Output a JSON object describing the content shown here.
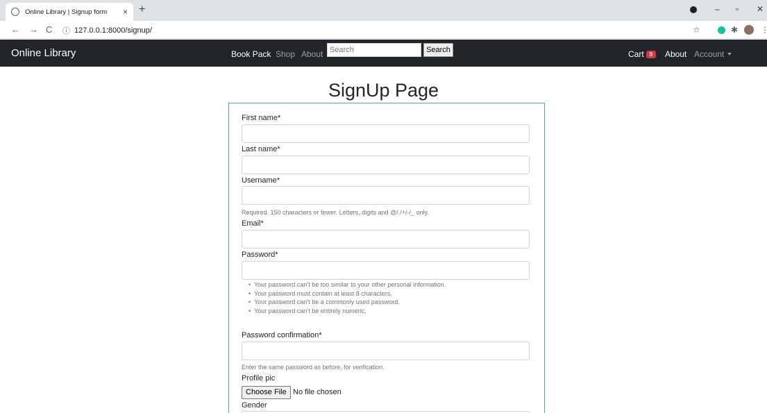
{
  "browser": {
    "tab_title": "Online Library | Signup form",
    "tab_close": "×",
    "new_tab": "+",
    "url": "127.0.0.1:8000/signup/",
    "nav": {
      "back": "←",
      "forward": "→",
      "reload": "C",
      "info": "ⓘ"
    },
    "window": {
      "minimize": "–",
      "maximize": "▫",
      "close": "✕"
    },
    "extensions": {
      "star": "☆",
      "puzzle": "✱",
      "menu": "⋮"
    }
  },
  "navbar": {
    "brand": "Online Library",
    "links": [
      "Book Pack",
      "Shop",
      "About"
    ],
    "search_placeholder": "Search",
    "search_button": "Search",
    "cart_label": "Cart",
    "cart_count": "0",
    "about_right": "About",
    "account": "Account"
  },
  "page": {
    "title": "SignUp Page"
  },
  "form": {
    "first_name_label": "First name*",
    "last_name_label": "Last name*",
    "username_label": "Username*",
    "username_help": "Required. 150 characters or fewer. Letters, digits and @/./+/-/_ only.",
    "email_label": "Email*",
    "password_label": "Password*",
    "password_rules": [
      "Your password can’t be too similar to your other personal information.",
      "Your password must contain at least 8 characters.",
      "Your password can’t be a commonly used password.",
      "Your password can’t be entirely numeric."
    ],
    "password_confirm_label": "Password confirmation*",
    "password_confirm_help": "Enter the same password as before, for verification.",
    "profile_pic_label": "Profile pic",
    "choose_file": "Choose File",
    "file_status": "No file chosen",
    "gender_label": "Gender"
  },
  "colors": {
    "navbar_bg": "#212529",
    "badge": "#dc3545",
    "form_border": "#4caf8e"
  }
}
